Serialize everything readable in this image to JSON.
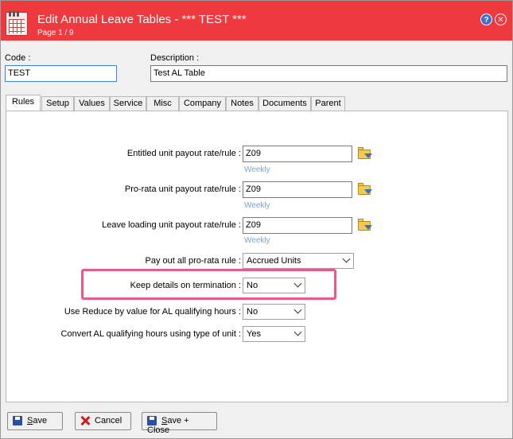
{
  "window": {
    "title": "Edit Annual Leave Tables - *** TEST ***",
    "subtitle": "Page 1 / 9",
    "help_icon": "?",
    "close_icon": "✕"
  },
  "header": {
    "code_label": "Code :",
    "code_value": "TEST",
    "description_label": "Description :",
    "description_value": "Test AL Table"
  },
  "tabs": [
    "Rules",
    "Setup",
    "Values",
    "Service",
    "Misc",
    "Company",
    "Notes",
    "Documents",
    "Parent"
  ],
  "active_tab": "Rules",
  "rules": {
    "entitled_label": "Entitled unit payout rate/rule :",
    "entitled_value": "Z09",
    "entitled_hint": "Weekly",
    "prorata_label": "Pro-rata unit payout rate/rule :",
    "prorata_value": "Z09",
    "prorata_hint": "Weekly",
    "loading_label": "Leave loading unit payout rate/rule :",
    "loading_value": "Z09",
    "loading_hint": "Weekly",
    "payout_label": "Pay out all pro-rata rule :",
    "payout_value": "Accrued Units",
    "keep_label": "Keep details on termination :",
    "keep_value": "No",
    "reduce_label": "Use Reduce by value for AL qualifying hours :",
    "reduce_value": "No",
    "convert_label": "Convert AL qualifying hours using type of unit :",
    "convert_value": "Yes"
  },
  "footer": {
    "save_first": "S",
    "save_rest": "ave",
    "cancel_label": "Cancel",
    "saveclose_first": "S",
    "saveclose_rest": "ave + Close"
  },
  "colors": {
    "titlebar": "#ee3a3f",
    "hint": "#7ea2cf",
    "highlight": "#e85b86"
  }
}
